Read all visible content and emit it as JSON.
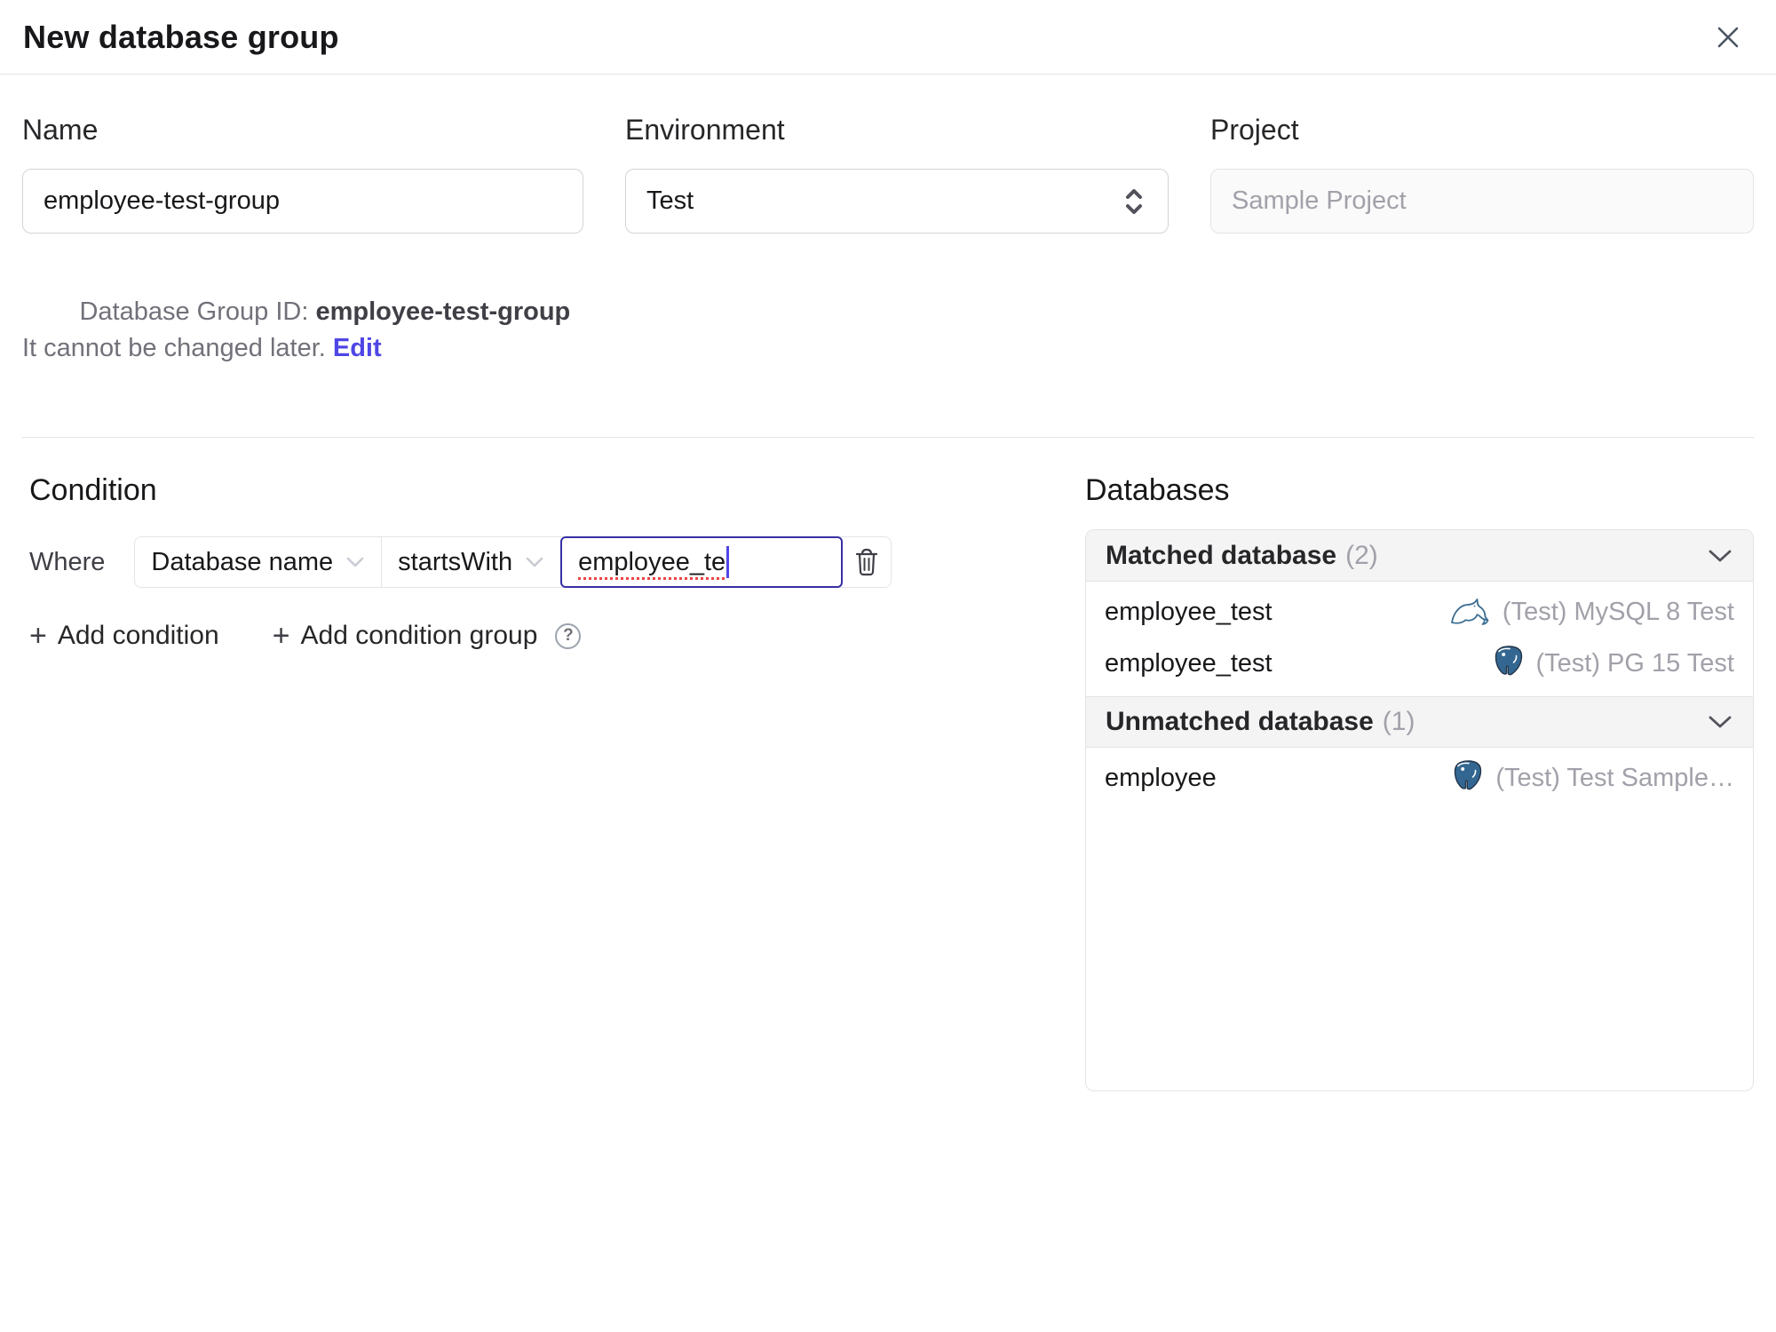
{
  "dialog": {
    "title": "New database group"
  },
  "form": {
    "name": {
      "label": "Name",
      "value": "employee-test-group"
    },
    "environment": {
      "label": "Environment",
      "value": "Test"
    },
    "project": {
      "label": "Project",
      "value": "Sample Project"
    },
    "helper": {
      "prefix": "Database Group ID: ",
      "group_id": "employee-test-group",
      "suffix": " It cannot be changed later. ",
      "edit_link": "Edit"
    }
  },
  "condition": {
    "heading": "Condition",
    "where_label": "Where",
    "field_selected": "Database name",
    "operator_selected": "startsWith",
    "value": "employee_te",
    "add_condition_label": "Add condition",
    "add_condition_group_label": "Add condition group",
    "plus_glyph": "+",
    "help_glyph": "?"
  },
  "databases": {
    "heading": "Databases",
    "groups": [
      {
        "title": "Matched database",
        "count": "(2)",
        "rows": [
          {
            "name": "employee_test",
            "engine": "mysql",
            "instance": "(Test) MySQL 8 Test"
          },
          {
            "name": "employee_test",
            "engine": "postgresql",
            "instance": "(Test) PG 15 Test"
          }
        ]
      },
      {
        "title": "Unmatched database",
        "count": "(1)",
        "rows": [
          {
            "name": "employee",
            "engine": "postgresql",
            "instance": "(Test) Test Sample…"
          }
        ]
      }
    ]
  },
  "colors": {
    "accent": "#4f46e5",
    "focus_border": "#3730a3",
    "spellcheck_red": "#ef4444",
    "border": "#e4e4e7",
    "group_header_bg": "#f4f4f5",
    "muted_text": "#a1a1aa",
    "mysql_icon": "#3d6e93",
    "postgres_icon": "#336791"
  }
}
